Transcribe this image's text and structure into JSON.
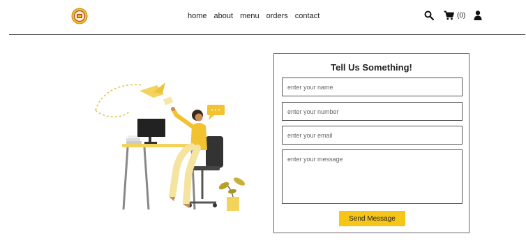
{
  "nav": {
    "links": [
      "home",
      "about",
      "menu",
      "orders",
      "contact"
    ]
  },
  "header": {
    "cart_count": "(0)",
    "icons": [
      "search-icon",
      "cart-icon",
      "user-icon"
    ]
  },
  "form": {
    "title": "Tell Us Something!",
    "name_placeholder": "enter your name",
    "number_placeholder": "enter your number",
    "email_placeholder": "enter your email",
    "message_placeholder": "enter your message",
    "submit_label": "Send Message"
  },
  "colors": {
    "accent": "#f5c518",
    "border": "#555555",
    "text": "#222222"
  }
}
